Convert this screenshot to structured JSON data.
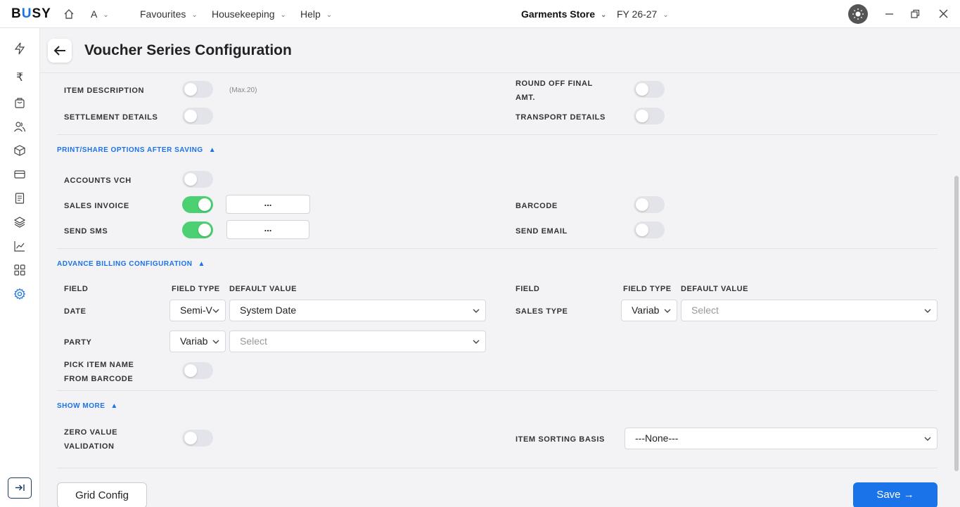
{
  "app": {
    "logo": "BUSY",
    "company_menu": "A",
    "menus": [
      "Favourites",
      "Housekeeping",
      "Help"
    ],
    "store": "Garments Store",
    "fiscal_year": "FY 26-27"
  },
  "header": {
    "title": "Voucher Series Configuration"
  },
  "rows_top": {
    "item_description": "ITEM DESCRIPTION",
    "item_description_hint": "(Max.20)",
    "round_off_line1": "ROUND OFF FINAL",
    "round_off_line2": "AMT.",
    "settlement_details": "SETTLEMENT DETAILS",
    "transport_details": "TRANSPORT DETAILS"
  },
  "print_section": {
    "title": "PRINT/SHARE OPTIONS AFTER SAVING",
    "accounts_vch": "ACCOUNTS VCH",
    "sales_invoice": "SALES INVOICE",
    "sales_invoice_btn": "...",
    "send_sms": "SEND SMS",
    "send_sms_btn": "...",
    "barcode": "BARCODE",
    "send_email": "SEND EMAIL"
  },
  "advance_section": {
    "title": "ADVANCE BILLING CONFIGURATION",
    "col_field": "FIELD",
    "col_field_type": "FIELD TYPE",
    "col_default_value": "DEFAULT VALUE",
    "date_label": "DATE",
    "date_type": "Semi-V",
    "date_default": "System Date",
    "party_label": "PARTY",
    "party_type": "Variab",
    "party_default": "Select",
    "pick_item_line1": "PICK ITEM NAME",
    "pick_item_line2": "FROM BARCODE",
    "sales_type_label": "SALES TYPE",
    "sales_type_type": "Variab",
    "sales_type_default": "Select"
  },
  "more_section": {
    "title": "SHOW MORE",
    "zero_value_line1": "ZERO VALUE",
    "zero_value_line2": "VALIDATION",
    "item_sorting_label": "ITEM SORTING BASIS",
    "item_sorting_value": "---None---"
  },
  "toggles": {
    "item_description": false,
    "round_off": false,
    "settlement_details": false,
    "transport_details": false,
    "accounts_vch": false,
    "sales_invoice": true,
    "send_sms": true,
    "barcode": false,
    "send_email": false,
    "pick_item": false,
    "zero_value": false
  },
  "footer": {
    "grid_config": "Grid Config",
    "save": "Save"
  },
  "colors": {
    "accent": "#1a73e8",
    "toggle_on": "#4cd071",
    "toggle_off": "#e2e4ea"
  }
}
